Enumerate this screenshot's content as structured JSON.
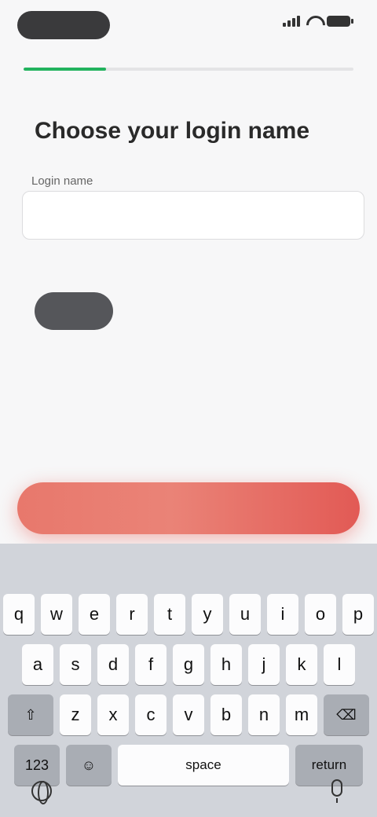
{
  "status_bar": {
    "time": ""
  },
  "progress": {
    "value_percent": 25
  },
  "page": {
    "title": "Choose your login name",
    "field_label": "Login name",
    "input_value": "",
    "input_placeholder": ""
  },
  "availability": {
    "chip_text": "",
    "status_text": ""
  },
  "suggestions": [],
  "rules": {
    "left": "",
    "right": ""
  },
  "continue_button": {
    "label": ""
  },
  "keyboard": {
    "predictions": [],
    "row1": [
      "q",
      "w",
      "e",
      "r",
      "t",
      "y",
      "u",
      "i",
      "o",
      "p"
    ],
    "row2": [
      "a",
      "s",
      "d",
      "f",
      "g",
      "h",
      "j",
      "k",
      "l"
    ],
    "row3": [
      "z",
      "x",
      "c",
      "v",
      "b",
      "n",
      "m"
    ],
    "shift_label": "⇧",
    "delete_label": "⌫",
    "numbers_label": "123",
    "emoji_label": "☺",
    "space_label": "space",
    "return_label": "return"
  }
}
